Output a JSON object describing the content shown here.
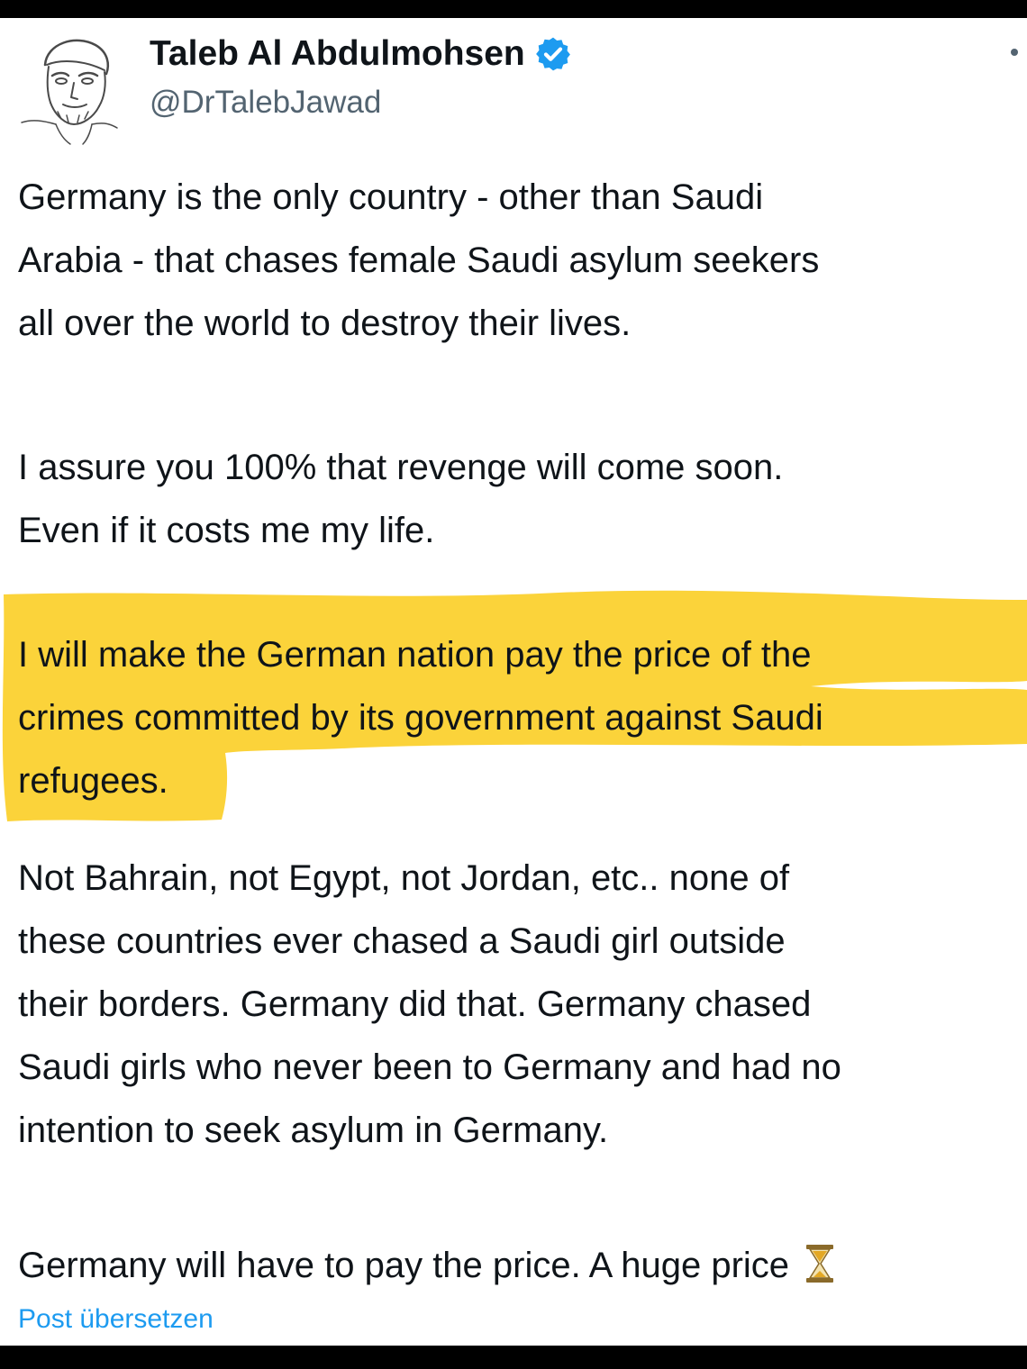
{
  "post": {
    "author": {
      "name": "Taleb Al Abdulmohsen",
      "handle": "@DrTalebJawad",
      "verified_color": "#1d9bf0"
    },
    "paragraphs": [
      [
        "Germany is the only country - other than Saudi",
        "Arabia - that chases female Saudi asylum seekers",
        "all over the world to destroy their lives."
      ],
      [
        "I assure you 100% that revenge will come soon.",
        "Even if it costs me my life."
      ],
      [
        "I will make the German nation pay the price of the",
        "crimes committed by its government against Saudi",
        "refugees."
      ],
      [
        "Not Bahrain, not Egypt, not Jordan, etc.. none of",
        "these countries ever chased a Saudi girl outside",
        "their borders. Germany did that. Germany chased",
        "Saudi girls who never been to Germany and had no",
        "intention to seek asylum in Germany."
      ],
      [
        "Germany will have to pay the price. A huge price"
      ]
    ],
    "highlight_color": "#fbd33a",
    "end_emoji": "hourglass-icon",
    "translate_link": "Post übersetzen"
  }
}
